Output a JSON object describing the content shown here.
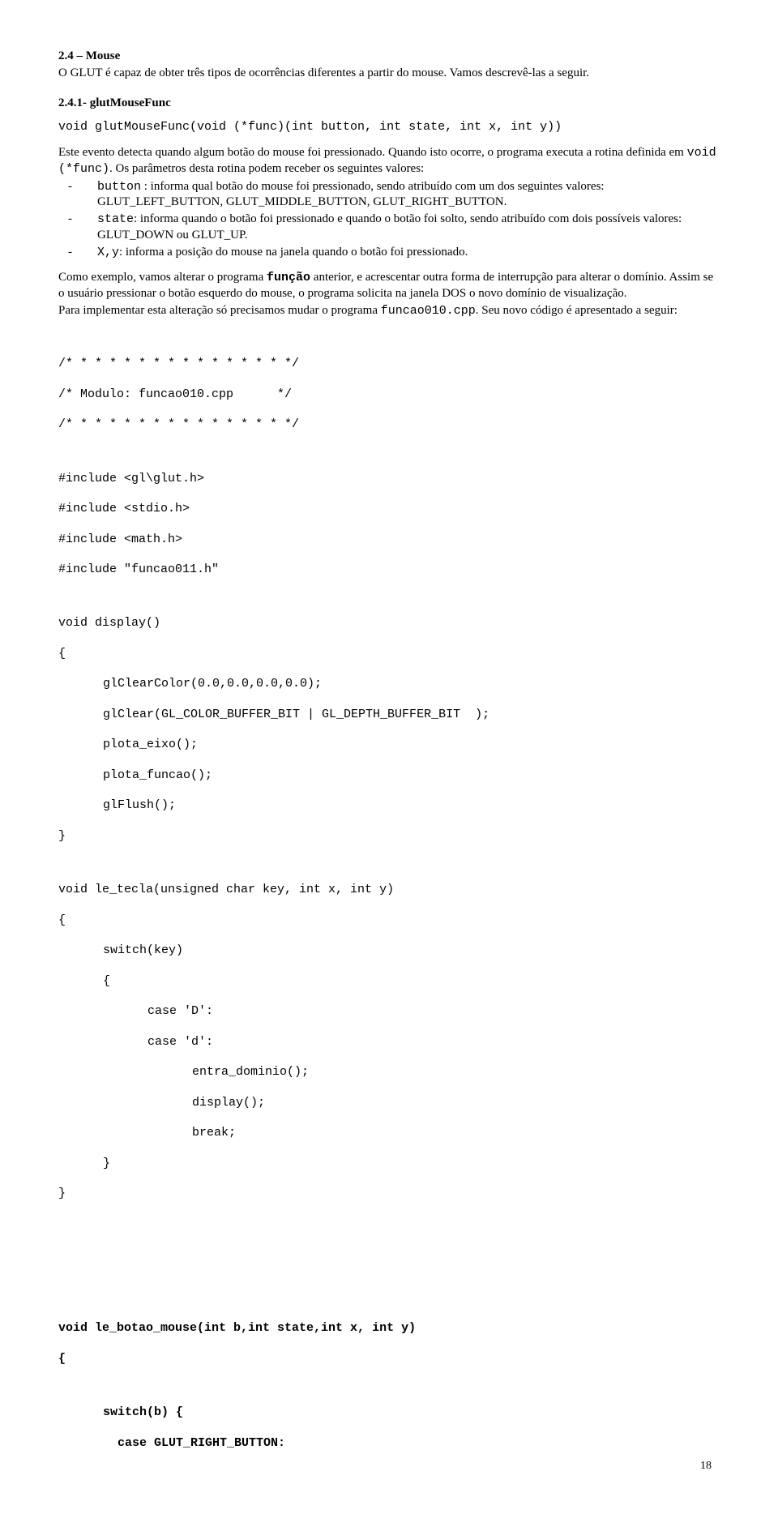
{
  "sec24": {
    "title": "2.4 – Mouse",
    "p1": "O GLUT é capaz de obter três tipos de ocorrências diferentes a partir do mouse. Vamos descrevê-las a seguir."
  },
  "sec241": {
    "title": "2.4.1- glutMouseFunc",
    "sig": "void glutMouseFunc(void (*func)(int button, int state, int x, int y))",
    "p2a": "Este evento detecta quando algum botão do mouse foi pressionado. Quando isto ocorre, o programa executa a rotina definida em ",
    "p2_code": "void (*func)",
    "p2b": ". Os parâmetros desta rotina podem receber os seguintes valores:",
    "b1_code": "button",
    "b1_txt": " : informa qual botão do mouse foi pressionado, sendo atribuído com um dos seguintes valores: GLUT_LEFT_BUTTON, GLUT_MIDDLE_BUTTON, GLUT_RIGHT_BUTTON.",
    "b2_code": "state",
    "b2_txt": ": informa quando o botão foi pressionado e quando o botão foi solto, sendo atribuído com dois possíveis valores: GLUT_DOWN ou GLUT_UP.",
    "b3_code": "X,y",
    "b3_txt": ": informa a posição do mouse na janela quando o botão foi pressionado.",
    "p3a": "Como exemplo, vamos alterar o programa ",
    "p3_code": "função",
    "p3b": " anterior, e acrescentar outra forma de interrupção para alterar o domínio. Assim se o usuário pressionar o botão esquerdo do mouse, o programa solicita na janela DOS o novo domínio de visualização.",
    "p4a": "Para implementar esta alteração só precisamos mudar o programa ",
    "p4_code": "funcao010.cpp",
    "p4b": ". Seu novo código é apresentado a seguir:"
  },
  "code": {
    "c01": "/* * * * * * * * * * * * * * * */",
    "c02": "/* Modulo: funcao010.cpp      */",
    "c03": "/* * * * * * * * * * * * * * * */",
    "c04": "#include <gl\\glut.h>",
    "c05": "#include <stdio.h>",
    "c06": "#include <math.h>",
    "c07": "#include \"funcao011.h\"",
    "c08": "void display()",
    "c09": "{",
    "c10": "glClearColor(0.0,0.0,0.0,0.0);",
    "c11": "glClear(GL_COLOR_BUFFER_BIT | GL_DEPTH_BUFFER_BIT  );",
    "c12": "plota_eixo();",
    "c13": "plota_funcao();",
    "c14": "glFlush();",
    "c15": "}",
    "c16": "void le_tecla(unsigned char key, int x, int y)",
    "c17": "{",
    "c18": "switch(key)",
    "c19": "{",
    "c20": "case 'D':",
    "c21": "case 'd':",
    "c22": "entra_dominio();",
    "c23": "display();",
    "c24": "break;",
    "c25": "}",
    "c26": "}",
    "c27": "void le_botao_mouse(int b,int state,int x, int y)",
    "c28": "{",
    "c29": "switch(b) {",
    "c30": "case GLUT_RIGHT_BUTTON:"
  },
  "pagenum": "18"
}
